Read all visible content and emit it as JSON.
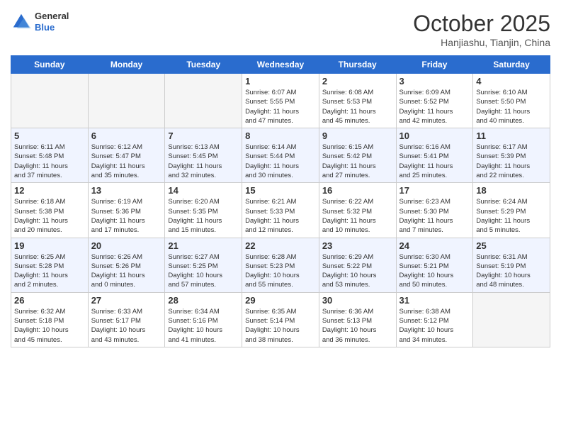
{
  "header": {
    "logo_general": "General",
    "logo_blue": "Blue",
    "month": "October 2025",
    "location": "Hanjiashu, Tianjin, China"
  },
  "weekdays": [
    "Sunday",
    "Monday",
    "Tuesday",
    "Wednesday",
    "Thursday",
    "Friday",
    "Saturday"
  ],
  "weeks": [
    [
      {
        "day": "",
        "info": ""
      },
      {
        "day": "",
        "info": ""
      },
      {
        "day": "",
        "info": ""
      },
      {
        "day": "1",
        "info": "Sunrise: 6:07 AM\nSunset: 5:55 PM\nDaylight: 11 hours\nand 47 minutes."
      },
      {
        "day": "2",
        "info": "Sunrise: 6:08 AM\nSunset: 5:53 PM\nDaylight: 11 hours\nand 45 minutes."
      },
      {
        "day": "3",
        "info": "Sunrise: 6:09 AM\nSunset: 5:52 PM\nDaylight: 11 hours\nand 42 minutes."
      },
      {
        "day": "4",
        "info": "Sunrise: 6:10 AM\nSunset: 5:50 PM\nDaylight: 11 hours\nand 40 minutes."
      }
    ],
    [
      {
        "day": "5",
        "info": "Sunrise: 6:11 AM\nSunset: 5:48 PM\nDaylight: 11 hours\nand 37 minutes."
      },
      {
        "day": "6",
        "info": "Sunrise: 6:12 AM\nSunset: 5:47 PM\nDaylight: 11 hours\nand 35 minutes."
      },
      {
        "day": "7",
        "info": "Sunrise: 6:13 AM\nSunset: 5:45 PM\nDaylight: 11 hours\nand 32 minutes."
      },
      {
        "day": "8",
        "info": "Sunrise: 6:14 AM\nSunset: 5:44 PM\nDaylight: 11 hours\nand 30 minutes."
      },
      {
        "day": "9",
        "info": "Sunrise: 6:15 AM\nSunset: 5:42 PM\nDaylight: 11 hours\nand 27 minutes."
      },
      {
        "day": "10",
        "info": "Sunrise: 6:16 AM\nSunset: 5:41 PM\nDaylight: 11 hours\nand 25 minutes."
      },
      {
        "day": "11",
        "info": "Sunrise: 6:17 AM\nSunset: 5:39 PM\nDaylight: 11 hours\nand 22 minutes."
      }
    ],
    [
      {
        "day": "12",
        "info": "Sunrise: 6:18 AM\nSunset: 5:38 PM\nDaylight: 11 hours\nand 20 minutes."
      },
      {
        "day": "13",
        "info": "Sunrise: 6:19 AM\nSunset: 5:36 PM\nDaylight: 11 hours\nand 17 minutes."
      },
      {
        "day": "14",
        "info": "Sunrise: 6:20 AM\nSunset: 5:35 PM\nDaylight: 11 hours\nand 15 minutes."
      },
      {
        "day": "15",
        "info": "Sunrise: 6:21 AM\nSunset: 5:33 PM\nDaylight: 11 hours\nand 12 minutes."
      },
      {
        "day": "16",
        "info": "Sunrise: 6:22 AM\nSunset: 5:32 PM\nDaylight: 11 hours\nand 10 minutes."
      },
      {
        "day": "17",
        "info": "Sunrise: 6:23 AM\nSunset: 5:30 PM\nDaylight: 11 hours\nand 7 minutes."
      },
      {
        "day": "18",
        "info": "Sunrise: 6:24 AM\nSunset: 5:29 PM\nDaylight: 11 hours\nand 5 minutes."
      }
    ],
    [
      {
        "day": "19",
        "info": "Sunrise: 6:25 AM\nSunset: 5:28 PM\nDaylight: 11 hours\nand 2 minutes."
      },
      {
        "day": "20",
        "info": "Sunrise: 6:26 AM\nSunset: 5:26 PM\nDaylight: 11 hours\nand 0 minutes."
      },
      {
        "day": "21",
        "info": "Sunrise: 6:27 AM\nSunset: 5:25 PM\nDaylight: 10 hours\nand 57 minutes."
      },
      {
        "day": "22",
        "info": "Sunrise: 6:28 AM\nSunset: 5:23 PM\nDaylight: 10 hours\nand 55 minutes."
      },
      {
        "day": "23",
        "info": "Sunrise: 6:29 AM\nSunset: 5:22 PM\nDaylight: 10 hours\nand 53 minutes."
      },
      {
        "day": "24",
        "info": "Sunrise: 6:30 AM\nSunset: 5:21 PM\nDaylight: 10 hours\nand 50 minutes."
      },
      {
        "day": "25",
        "info": "Sunrise: 6:31 AM\nSunset: 5:19 PM\nDaylight: 10 hours\nand 48 minutes."
      }
    ],
    [
      {
        "day": "26",
        "info": "Sunrise: 6:32 AM\nSunset: 5:18 PM\nDaylight: 10 hours\nand 45 minutes."
      },
      {
        "day": "27",
        "info": "Sunrise: 6:33 AM\nSunset: 5:17 PM\nDaylight: 10 hours\nand 43 minutes."
      },
      {
        "day": "28",
        "info": "Sunrise: 6:34 AM\nSunset: 5:16 PM\nDaylight: 10 hours\nand 41 minutes."
      },
      {
        "day": "29",
        "info": "Sunrise: 6:35 AM\nSunset: 5:14 PM\nDaylight: 10 hours\nand 38 minutes."
      },
      {
        "day": "30",
        "info": "Sunrise: 6:36 AM\nSunset: 5:13 PM\nDaylight: 10 hours\nand 36 minutes."
      },
      {
        "day": "31",
        "info": "Sunrise: 6:38 AM\nSunset: 5:12 PM\nDaylight: 10 hours\nand 34 minutes."
      },
      {
        "day": "",
        "info": ""
      }
    ]
  ]
}
